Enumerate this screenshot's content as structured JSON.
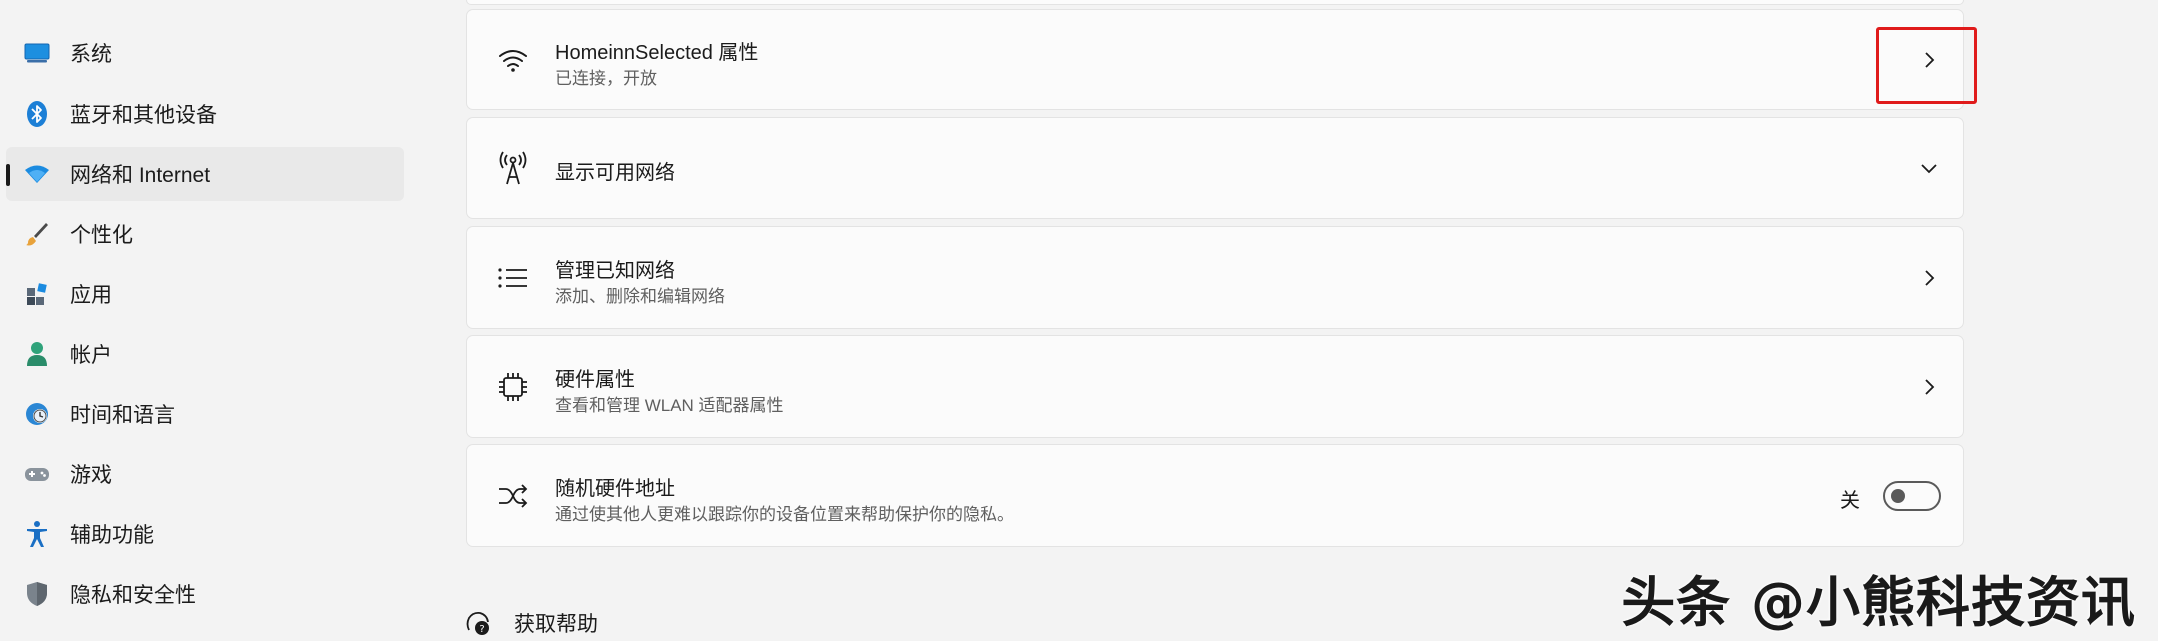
{
  "sidebar": {
    "items": [
      {
        "label": "系统",
        "icon": "monitor-icon",
        "active": false
      },
      {
        "label": "蓝牙和其他设备",
        "icon": "bluetooth-icon",
        "active": false
      },
      {
        "label": "网络和 Internet",
        "icon": "wifi-icon",
        "active": true
      },
      {
        "label": "个性化",
        "icon": "brush-icon",
        "active": false
      },
      {
        "label": "应用",
        "icon": "apps-icon",
        "active": false
      },
      {
        "label": "帐户",
        "icon": "person-icon",
        "active": false
      },
      {
        "label": "时间和语言",
        "icon": "globe-clock-icon",
        "active": false
      },
      {
        "label": "游戏",
        "icon": "gamepad-icon",
        "active": false
      },
      {
        "label": "辅助功能",
        "icon": "accessibility-icon",
        "active": false
      },
      {
        "label": "隐私和安全性",
        "icon": "shield-icon",
        "active": false
      }
    ]
  },
  "cards": [
    {
      "title": "HomeinnSelected 属性",
      "subtitle": "已连接，开放",
      "icon": "wifi-signal-icon",
      "action": "chevron-right"
    },
    {
      "title": "显示可用网络",
      "subtitle": "",
      "icon": "antenna-icon",
      "action": "chevron-down"
    },
    {
      "title": "管理已知网络",
      "subtitle": "添加、删除和编辑网络",
      "icon": "list-icon",
      "action": "chevron-right"
    },
    {
      "title": "硬件属性",
      "subtitle": "查看和管理 WLAN 适配器属性",
      "icon": "chip-icon",
      "action": "chevron-right"
    },
    {
      "title": "随机硬件地址",
      "subtitle": "通过使其他人更难以跟踪你的设备位置来帮助保护你的隐私。",
      "icon": "shuffle-icon",
      "action": "toggle"
    }
  ],
  "toggle": {
    "label": "关",
    "on": false
  },
  "help": {
    "label": "获取帮助",
    "icon": "help-icon"
  },
  "watermark": "头条 @小熊科技资讯",
  "colors": {
    "highlight": "#e01b1b",
    "accent": "#0067c0",
    "background": "#f3f3f3",
    "card": "#fbfbfb"
  }
}
